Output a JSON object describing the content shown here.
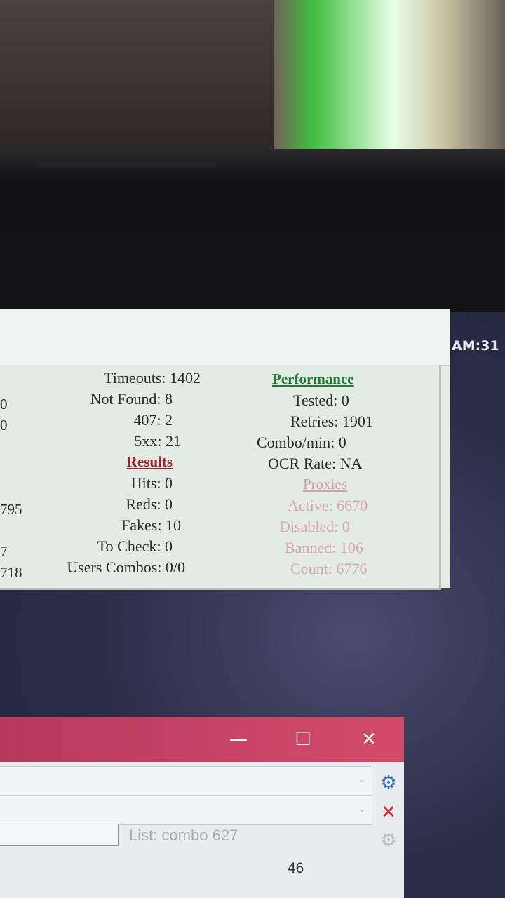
{
  "desktop": {
    "am_label": "AM:31"
  },
  "stats": {
    "left_column": [
      {
        "label": "Timeouts: 1402"
      },
      {
        "label": "Not Found: 8"
      },
      {
        "label": "407: 2"
      },
      {
        "label": "5xx: 21"
      },
      {
        "label": "Results",
        "header": true
      },
      {
        "label": "Hits: 0"
      },
      {
        "label": "Reds: 0"
      },
      {
        "label": "Fakes: 10"
      },
      {
        "label": "To Check: 0"
      },
      {
        "label": "Users Combos: 0/0"
      }
    ],
    "performance": {
      "header": "Performance",
      "tested": "Tested: 0",
      "retries": "Retries: 1901",
      "combo_min": "Combo/min: 0",
      "ocr_rate": "OCR Rate: NA"
    },
    "proxies": {
      "header": "Proxies",
      "active": "Active: 6670",
      "disabled": "Disabled: 0",
      "banned": "Banned: 106",
      "count": "Count: 6776"
    },
    "edge_numbers": [
      "0",
      "0",
      "795",
      "7",
      "718"
    ]
  },
  "lower_window": {
    "minimize_glyph": "—",
    "maximize_glyph": "☐",
    "close_glyph": "✕",
    "list_label": "List: combo 627",
    "count": "46",
    "icons": [
      "search-icon",
      "delete-icon",
      "settings-icon"
    ]
  },
  "colors": {
    "performance_header": "#1f7a34",
    "results_header": "#9a1f2c",
    "titlebar": "#c94466"
  }
}
